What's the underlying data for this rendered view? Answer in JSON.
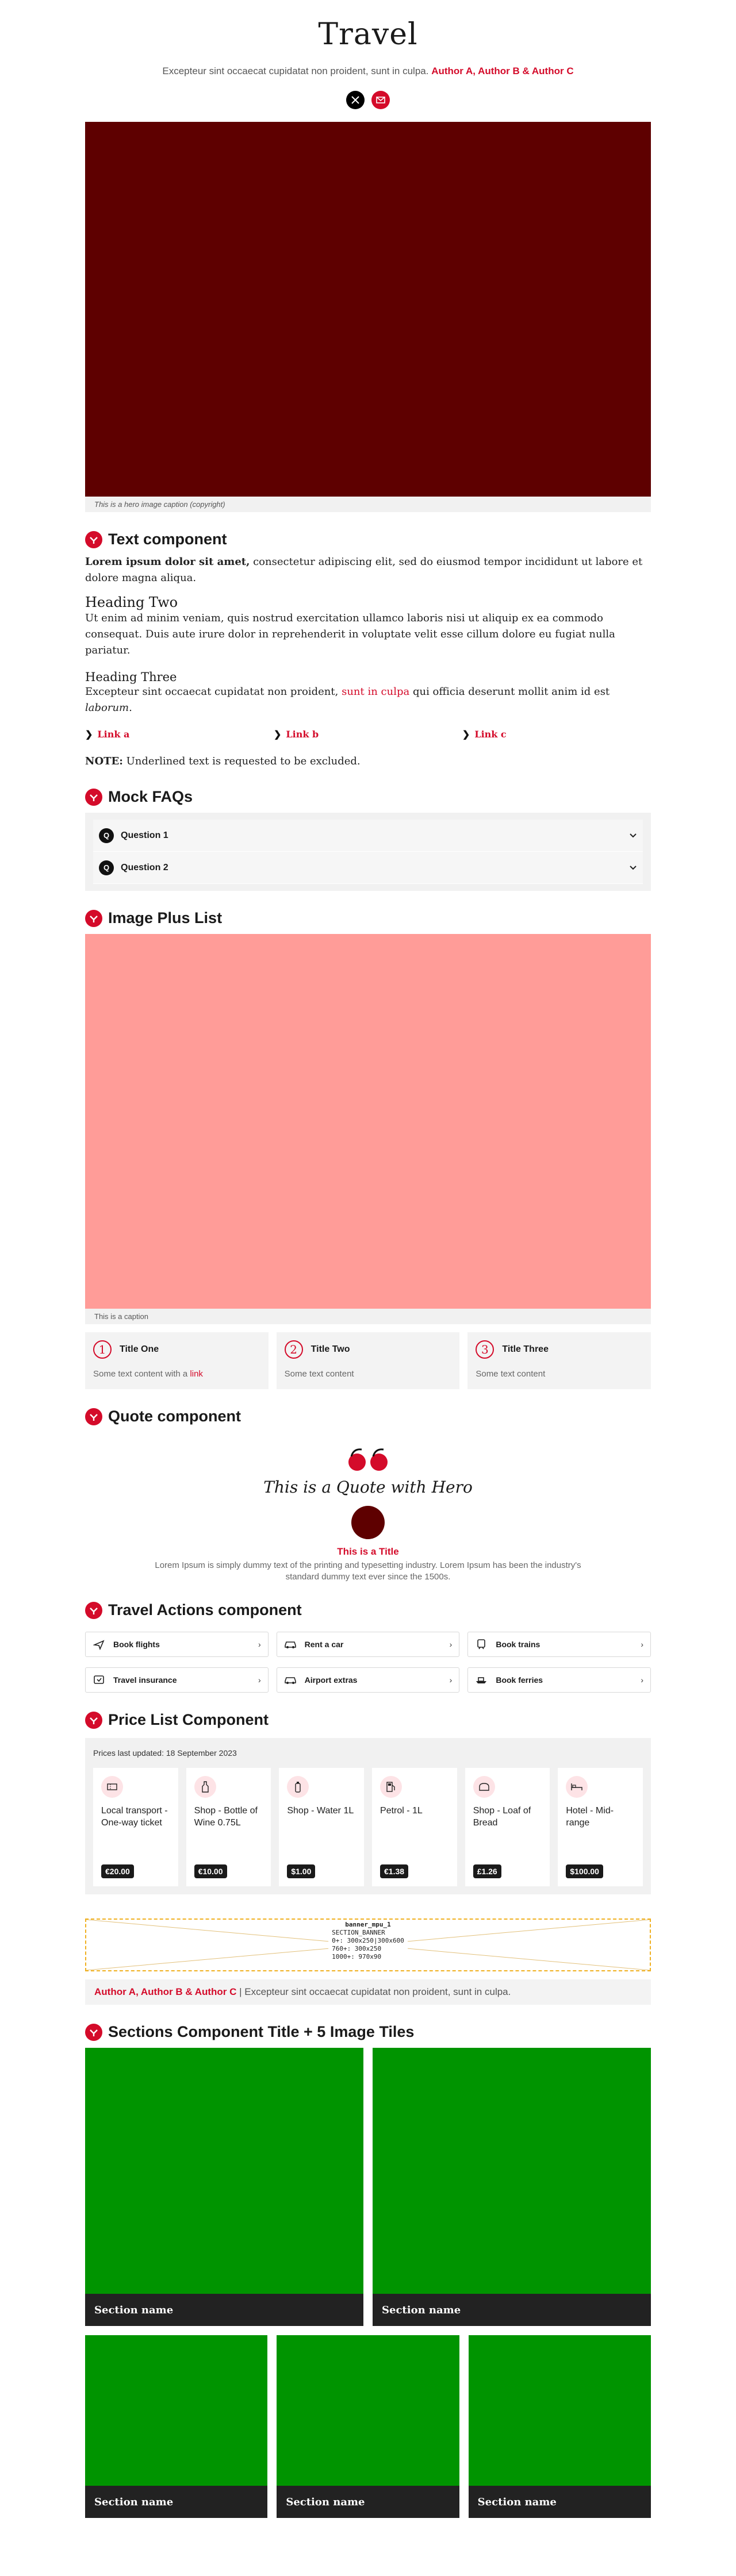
{
  "header": {
    "title": "Travel",
    "standfirst": "Excepteur sint occaecat cupidatat non proident, sunt in culpa.",
    "authors": "Author A, Author B & Author C",
    "social": [
      "x-share",
      "email-share"
    ]
  },
  "hero": {
    "caption": "This is a hero image caption (copyright)",
    "color": "#5e0000"
  },
  "text_component": {
    "title": "Text component",
    "p1_bold": "Lorem ipsum dolor sit amet,",
    "p1_rest": " consectetur adipiscing elit, sed do eiusmod tempor incididunt ut labore et dolore magna aliqua.",
    "h2": "Heading Two",
    "p2": "Ut enim ad minim veniam, quis nostrud exercitation ullamco laboris nisi ut aliquip ex ea commodo consequat. Duis aute irure dolor in reprehenderit in voluptate velit esse cillum dolore eu fugiat nulla pariatur.",
    "h3": "Heading Three",
    "p3_a": "Excepteur sint occaecat cupidatat non proident, ",
    "p3_link": "sunt in culpa",
    "p3_b": " qui officia deserunt mollit anim id est ",
    "p3_italic": "laborum",
    "p3_end": ".",
    "links": [
      "Link a",
      "Link b",
      "Link c"
    ],
    "note_label": "NOTE:",
    "note_text": " Underlined text is requested to be excluded."
  },
  "faq": {
    "title": "Mock FAQs",
    "badge": "Q",
    "questions": [
      "Question 1",
      "Question 2"
    ]
  },
  "image_plus_list": {
    "title": "Image Plus List",
    "caption": "This is a caption",
    "color": "#ff9c98",
    "items": [
      {
        "num": "1",
        "title": "Title One",
        "text": "Some text content with a ",
        "link": "link"
      },
      {
        "num": "2",
        "title": "Title Two",
        "text": "Some text content"
      },
      {
        "num": "3",
        "title": "Title Three",
        "text": "Some text content"
      }
    ]
  },
  "quote": {
    "section_title": "Quote component",
    "quote": "This is a Quote with Hero",
    "name": "This is a Title",
    "text": "Lorem Ipsum is simply dummy text of the printing and typesetting industry. Lorem Ipsum has been the industry's standard dummy text ever since the 1500s."
  },
  "travel_actions": {
    "title": "Travel Actions component",
    "items": [
      {
        "label": "Book flights",
        "icon": "plane-icon"
      },
      {
        "label": "Rent a car",
        "icon": "car-icon"
      },
      {
        "label": "Book trains",
        "icon": "train-icon"
      },
      {
        "label": "Travel insurance",
        "icon": "insurance-icon"
      },
      {
        "label": "Airport extras",
        "icon": "airport-car-icon"
      },
      {
        "label": "Book ferries",
        "icon": "ferry-icon"
      }
    ]
  },
  "price_list": {
    "title": "Price List Component",
    "updated": "Prices last updated: 18 September 2023",
    "items": [
      {
        "name": "Local transport - One-way ticket",
        "price": "€20.00",
        "icon": "ticket-icon"
      },
      {
        "name": "Shop - Bottle of Wine 0.75L",
        "price": "€10.00",
        "icon": "wine-icon"
      },
      {
        "name": "Shop - Water 1L",
        "price": "$1.00",
        "icon": "water-bottle-icon"
      },
      {
        "name": "Petrol - 1L",
        "price": "€1.38",
        "icon": "petrol-icon"
      },
      {
        "name": "Shop - Loaf of Bread",
        "price": "£1.26",
        "icon": "bread-icon"
      },
      {
        "name": "Hotel - Mid-range",
        "price": "$100.00",
        "icon": "hotel-icon"
      }
    ]
  },
  "banner": {
    "name": "banner_mpu_1",
    "lines": [
      "SECTION_BANNER",
      "0+: 300x250|300x600",
      "760+: 300x250",
      "1000+: 970x90"
    ]
  },
  "author_strip": {
    "authors": "Author A, Author B & Author C",
    "separator": " | ",
    "text": "Excepteur sint occaecat cupidatat non proident, sunt in culpa."
  },
  "sections": {
    "title": "Sections Component Title + 5 Image Tiles",
    "tiles": [
      "Section name",
      "Section name",
      "Section name",
      "Section name",
      "Section name"
    ],
    "color": "#009400"
  },
  "colors": {
    "accent": "#d40b2a",
    "dark": "#1a1a1a"
  }
}
